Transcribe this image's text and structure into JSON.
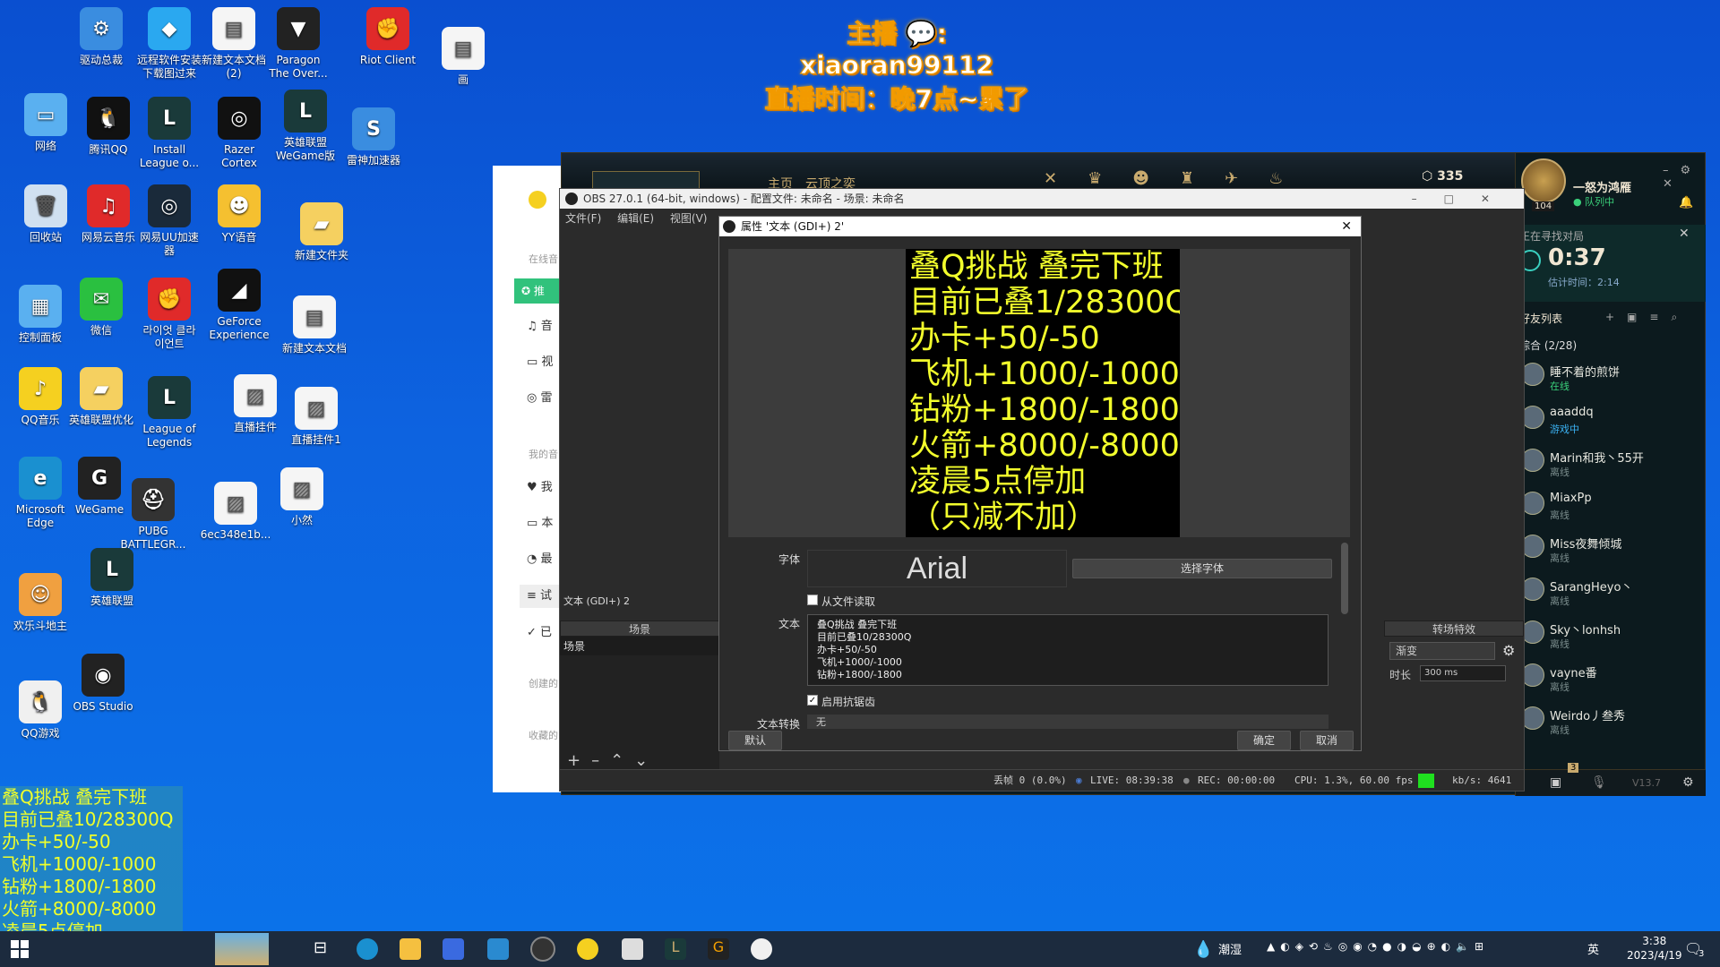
{
  "desktop_icons": [
    {
      "label": "驱动总裁",
      "color": "#3a8de0",
      "glyph": "⚙"
    },
    {
      "label": "远程软件安装\n下载图过来",
      "color": "#2aa8f0",
      "glyph": "◆"
    },
    {
      "label": "新建文本文档\n(2)",
      "color": "#f5f5f5",
      "glyph": "▤"
    },
    {
      "label": "Paragon\nThe Over...",
      "color": "#222",
      "glyph": "▼"
    },
    {
      "label": "Riot Client",
      "color": "#e02a2a",
      "glyph": "✊"
    },
    {
      "label": "画",
      "color": "#f5f5f5",
      "glyph": "▤"
    },
    {
      "label": "网络",
      "color": "#5ab0f0",
      "glyph": "▭"
    },
    {
      "label": "腾讯QQ",
      "color": "#111",
      "glyph": "🐧"
    },
    {
      "label": "Install\nLeague o...",
      "color": "#1a3a3a",
      "glyph": "L"
    },
    {
      "label": "Razer\nCortex",
      "color": "#111",
      "glyph": "◎"
    },
    {
      "label": "英雄联盟\nWeGame版",
      "color": "#1a3a3a",
      "glyph": "L"
    },
    {
      "label": "雷神加速器",
      "color": "#3a8de0",
      "glyph": "S"
    },
    {
      "label": "回收站",
      "color": "#d0e0f0",
      "glyph": "🗑"
    },
    {
      "label": "网易云音乐",
      "color": "#e02a2a",
      "glyph": "♫"
    },
    {
      "label": "网易UU加速\n器",
      "color": "#1a2a3a",
      "glyph": "◎"
    },
    {
      "label": "YY语音",
      "color": "#f5c030",
      "glyph": "☻"
    },
    {
      "label": "新建文件夹",
      "color": "#f5d060",
      "glyph": "▰"
    },
    {
      "label": "控制面板",
      "color": "#5ab0f0",
      "glyph": "▦"
    },
    {
      "label": "微信",
      "color": "#2ac040",
      "glyph": "✉"
    },
    {
      "label": "라이엇 클라\n이언트",
      "color": "#e02a2a",
      "glyph": "✊"
    },
    {
      "label": "GeForce\nExperience",
      "color": "#111",
      "glyph": "◢"
    },
    {
      "label": "新建文本文档",
      "color": "#f5f5f5",
      "glyph": "▤"
    },
    {
      "label": "QQ音乐",
      "color": "#f5d020",
      "glyph": "♪"
    },
    {
      "label": "英雄联盟优化",
      "color": "#f5d060",
      "glyph": "▰"
    },
    {
      "label": "League of\nLegends",
      "color": "#1a3a3a",
      "glyph": "L"
    },
    {
      "label": "直播挂件",
      "color": "#f5f5f5",
      "glyph": "▨"
    },
    {
      "label": "直播挂件1",
      "color": "#f5f5f5",
      "glyph": "▨"
    },
    {
      "label": "Microsoft\nEdge",
      "color": "#1a90d0",
      "glyph": "e"
    },
    {
      "label": "WeGame",
      "color": "#222",
      "glyph": "G"
    },
    {
      "label": "PUBG\nBATTLEGR...",
      "color": "#333",
      "glyph": "⛑"
    },
    {
      "label": "6ec348e1b...",
      "color": "#f5f5f5",
      "glyph": "▨"
    },
    {
      "label": "小然",
      "color": "#f5f5f5",
      "glyph": "▨"
    },
    {
      "label": "欢乐斗地主",
      "color": "#f0a040",
      "glyph": "☺"
    },
    {
      "label": "英雄联盟",
      "color": "#1a3a3a",
      "glyph": "L"
    },
    {
      "label": "OBS Studio",
      "color": "#222",
      "glyph": "◉"
    },
    {
      "label": "QQ游戏",
      "color": "#f0f0f0",
      "glyph": "🐧"
    }
  ],
  "banner": {
    "line1": "主播 💬: xiaoran99112",
    "line2": "直播时间：晚7点~累了"
  },
  "overlay_lines": [
    "叠Q挑战 叠完下班",
    "目前已叠10/28300Q",
    "办卡+50/-50",
    "飞机+1000/-1000",
    "钻粉+1800/-1800",
    "火箭+8000/-8000",
    "凌晨5点停加",
    "（只减不加）"
  ],
  "music": {
    "labels": [
      "在线音",
      "我的音",
      "创建的",
      "收藏的"
    ],
    "items": [
      "推",
      "音",
      "视",
      "雷",
      "我",
      "本",
      "最",
      "试",
      "已"
    ]
  },
  "lol": {
    "currency": "335",
    "player_name": "一怒为鸿雁",
    "player_status": "队列中",
    "level": "104",
    "queue_label": "正在寻找对局",
    "queue_time": "0:37",
    "estimate": "估计时间：2:14",
    "friends_title": "好友列表",
    "group_label": "综合 (2/28)",
    "friends": [
      {
        "name": "睡不着的煎饼",
        "status": "在线",
        "color": "#3ad07a"
      },
      {
        "name": "aaaddq",
        "status": "游戏中",
        "color": "#3ab0f0"
      },
      {
        "name": "Marin和我丶55开",
        "status": "离线",
        "color": "#7a8c8c"
      },
      {
        "name": "MiaxPp",
        "status": "离线",
        "color": "#7a8c8c"
      },
      {
        "name": "Miss夜舞倾城",
        "status": "离线",
        "color": "#7a8c8c"
      },
      {
        "name": "SarangHeyo丶",
        "status": "离线",
        "color": "#7a8c8c"
      },
      {
        "name": "Sky丶lonhsh",
        "status": "离线",
        "color": "#7a8c8c"
      },
      {
        "name": "vayne番",
        "status": "离线",
        "color": "#7a8c8c"
      },
      {
        "name": "Weirdo丿叁秀",
        "status": "离线",
        "color": "#7a8c8c"
      }
    ],
    "version": "V13.7",
    "badge": "3"
  },
  "obs": {
    "title": "OBS 27.0.1 (64-bit, windows) - 配置文件: 未命名 - 场景: 未命名",
    "menu": [
      "文件(F)",
      "编辑(E)",
      "视图(V)"
    ],
    "source_label": "文本 (GDI+) 2",
    "scenes_header": "场景",
    "scene_item": "场景",
    "transition_header": "转场特效",
    "transition_value": "渐变",
    "duration_label": "时长",
    "duration_value": "300 ms",
    "status": {
      "dropped": "丢帧 0 (0.0%)",
      "live": "LIVE: 08:39:38",
      "rec": "REC: 00:00:00",
      "cpu": "CPU: 1.3%, 60.00 fps",
      "kbps": "kb/s: 4641"
    }
  },
  "props": {
    "title": "属性 '文本 (GDI+) 2'",
    "preview_lines": [
      "叠Q挑战 叠完下班",
      "目前已叠1/28300Q",
      "办卡+50/-50",
      "飞机+1000/-1000",
      "钻粉+1800/-1800",
      "火箭+8000/-8000",
      "凌晨5点停加",
      "（只减不加）"
    ],
    "font_label": "字体",
    "font_value": "Arial",
    "select_font": "选择字体",
    "read_from_file": "从文件读取",
    "text_label": "文本",
    "text_lines": [
      "叠Q挑战 叠完下班",
      "目前已叠10/28300Q",
      "办卡+50/-50",
      "飞机+1000/-1000",
      "钻粉+1800/-1800"
    ],
    "antialias": "启用抗锯齿",
    "transform_label": "文本转换",
    "transform_value": "无",
    "default_btn": "默认",
    "ok_btn": "确定",
    "cancel_btn": "取消"
  },
  "taskbar": {
    "weather": "潮湿",
    "ime": "英",
    "time": "3:38",
    "date": "2023/4/19",
    "notif": "3"
  }
}
